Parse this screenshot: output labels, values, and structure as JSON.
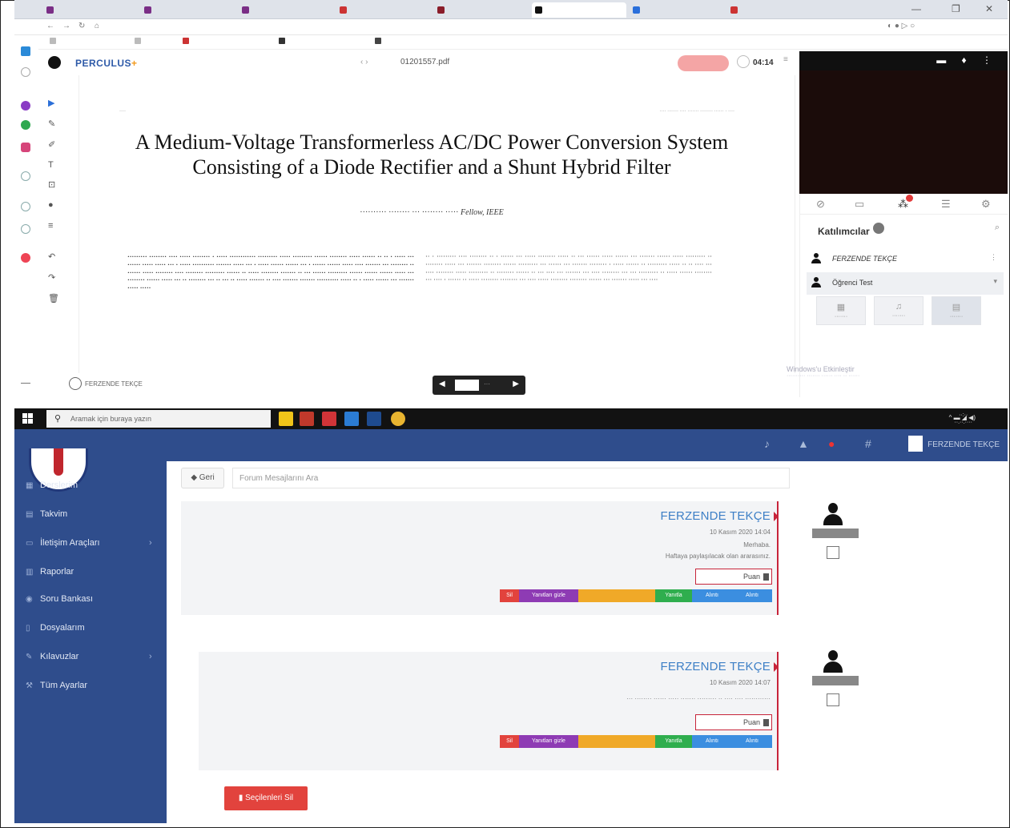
{
  "colors": {
    "perculus_blue": "#2e5aa8",
    "perculus_orange": "#f29a1e",
    "lms_nav": "#2f4d8c",
    "author_blue": "#3d7fc6",
    "accent_red": "#c7243a",
    "delete_red": "#e2433d"
  },
  "browser": {
    "tabs": [
      "",
      "",
      "",
      "",
      "",
      "",
      "",
      "",
      "",
      ""
    ],
    "address": ""
  },
  "perculus": {
    "logo": "PERCULUS",
    "file_name": "01201557.pdf",
    "timer": "04:14",
    "participants_title": "Katılımcılar",
    "participants": [
      {
        "name": "FERZENDE TEKÇE"
      },
      {
        "name": "Öğrenci Test"
      }
    ],
    "footer_user": "FERZENDE TEKÇE",
    "windows_activate": "Windows'u Etkinleştir"
  },
  "paper": {
    "title": "A Medium-Voltage Transformerless AC/DC Power Conversion System Consisting of a Diode Rectifier and a Shunt Hybrid Filter",
    "authors": "Fellow, IEEE"
  },
  "taskbar": {
    "search_placeholder": "Aramak için buraya yazın"
  },
  "lms": {
    "sidebar": [
      {
        "label": "Derslerim",
        "icon": "grid-icon",
        "has_sub": false
      },
      {
        "label": "Takvim",
        "icon": "calendar-icon",
        "has_sub": false
      },
      {
        "label": "İletişim Araçları",
        "icon": "chat-icon",
        "has_sub": true
      },
      {
        "label": "Raporlar",
        "icon": "chart-icon",
        "has_sub": false
      },
      {
        "label": "Soru Bankası",
        "icon": "database-icon",
        "has_sub": false
      },
      {
        "label": "Dosyalarım",
        "icon": "file-icon",
        "has_sub": false
      },
      {
        "label": "Kılavuzlar",
        "icon": "book-icon",
        "has_sub": true
      },
      {
        "label": "Tüm Ayarlar",
        "icon": "wrench-icon",
        "has_sub": false
      }
    ],
    "back_label": "Geri",
    "search_placeholder": "Forum Mesajlarını Ara",
    "user": "FERZENDE TEKÇE",
    "posts": [
      {
        "author": "FERZENDE TEKÇE",
        "date": "10 Kasım 2020 14:04",
        "line1": "Merhaba.",
        "line2": "Haftaya paylaşılacak olan ararasınız.",
        "score_label": "Puan",
        "buttons": [
          "Sil",
          "Yanıtları gizle",
          "",
          "Yanıtla",
          "Alıntı",
          "Alıntı"
        ]
      },
      {
        "author": "FERZENDE TEKÇE",
        "date": "10 Kasım 2020 14:07",
        "line1": "",
        "line2": "",
        "score_label": "Puan",
        "buttons": [
          "Sil",
          "Yanıtları gizle",
          "",
          "Yanıtla",
          "Alıntı",
          "Alıntı"
        ]
      }
    ],
    "delete_selected": "Seçilenleri Sil"
  }
}
